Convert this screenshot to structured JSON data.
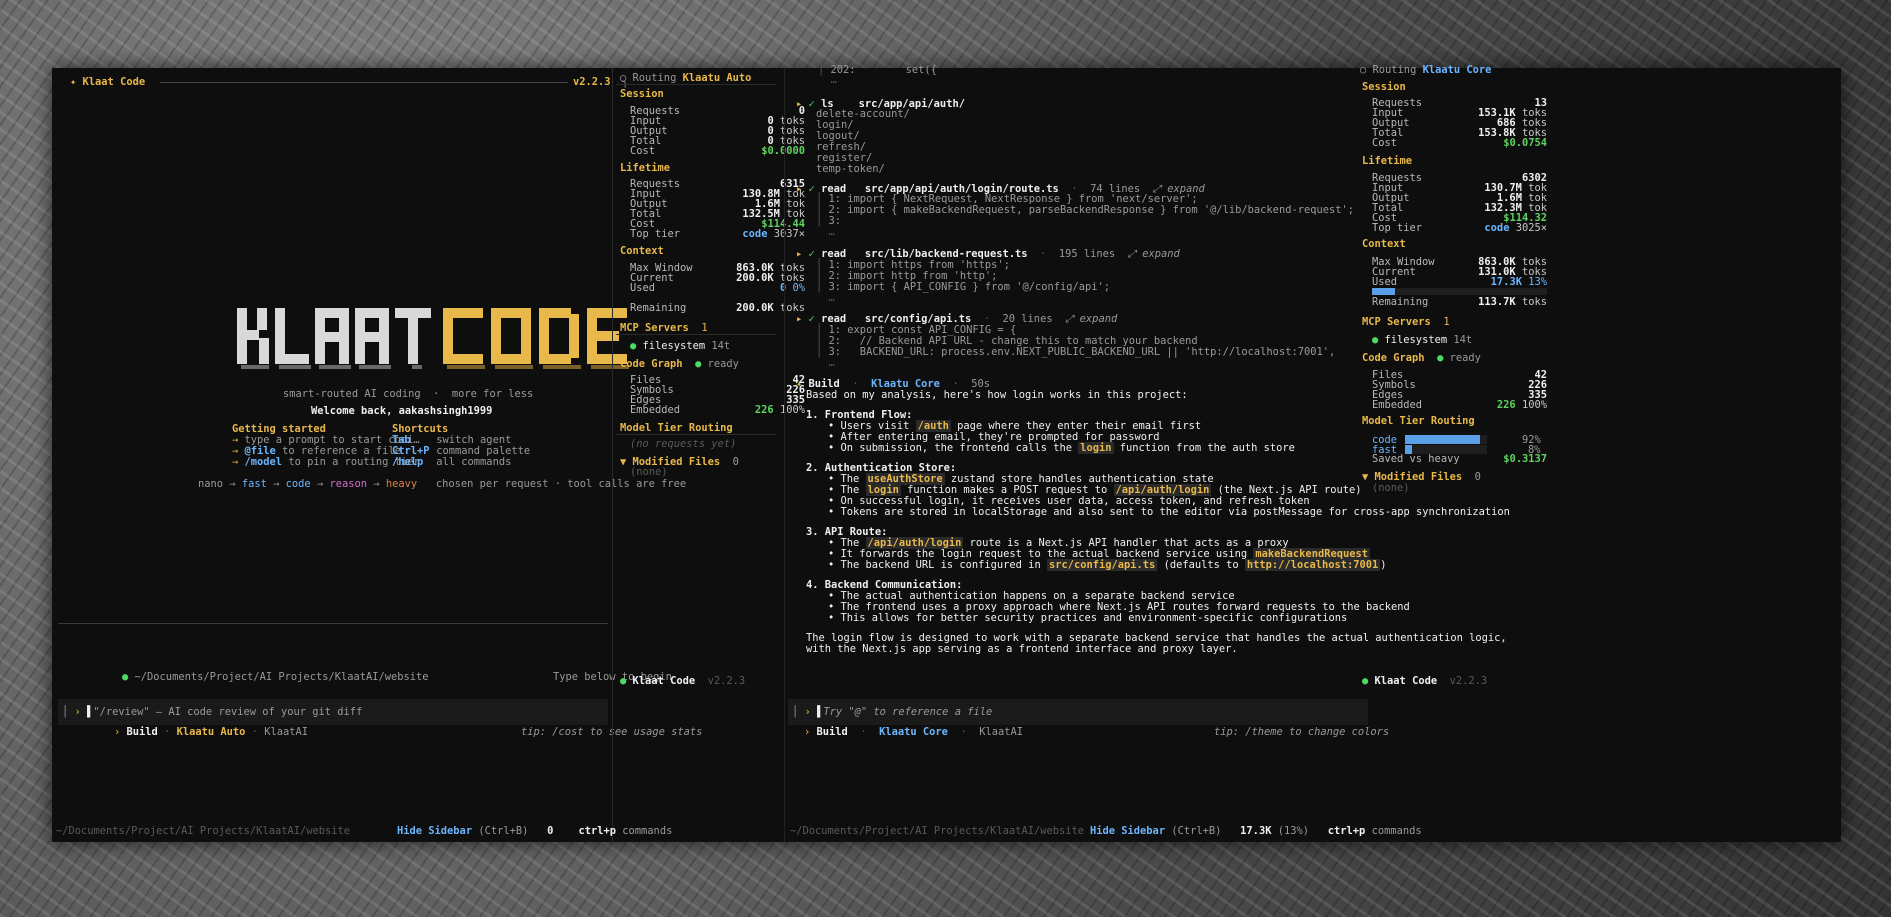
{
  "window1": {
    "title_icon": "✦",
    "title": "Klaat Code",
    "version": "v2.2.3",
    "logo_left": "KLAAT",
    "logo_right": "CODE",
    "tagline": "smart-routed AI coding  ·  more for less",
    "welcome": "Welcome back, aakashsingh1999",
    "getting_started": {
      "heading": "Getting started",
      "items": [
        {
          "arrow": "→",
          "key": "",
          "text": "type a prompt to start codi…"
        },
        {
          "arrow": "→",
          "key": "@file",
          "text": " to reference a file"
        },
        {
          "arrow": "→",
          "key": "/model",
          "text": " to pin a routing tier"
        }
      ]
    },
    "shortcuts": {
      "heading": "Shortcuts",
      "items": [
        {
          "key": "Tab",
          "text": "switch agent"
        },
        {
          "key": "Ctrl+P",
          "text": "command palette"
        },
        {
          "key": "/help",
          "text": "all commands"
        }
      ]
    },
    "tiers": [
      "nano",
      "fast",
      "code",
      "reason",
      "heavy"
    ],
    "tier_note": "chosen per request · tool calls are free",
    "path": "~/Documents/Project/AI Projects/KlaatAI/website",
    "type_hint": "Type below to begin",
    "input_placeholder": "\"/review\" — AI code review of your git diff",
    "mode": "Build",
    "model": "Klaatu Auto",
    "workspace": "KlaatAI",
    "tip": "tip: /cost to see usage stats",
    "footer_path": "~/Documents/Project/AI Projects/KlaatAI/website",
    "hide_sidebar": "Hide Sidebar",
    "hide_sidebar_key": "(Ctrl+B)",
    "token_count": "0",
    "cmd_key": "ctrl+p",
    "cmd_label": "commands"
  },
  "sidebar1": {
    "routing_label": "Routing",
    "routing_value": "Klaatu Auto",
    "session": {
      "heading": "Session",
      "rows": [
        {
          "k": "Requests",
          "v": "0",
          "u": ""
        },
        {
          "k": "Input",
          "v": "0",
          "u": "toks"
        },
        {
          "k": "Output",
          "v": "0",
          "u": "toks"
        },
        {
          "k": "Total",
          "v": "0",
          "u": "toks"
        },
        {
          "k": "Cost",
          "v": "$0.0000",
          "u": ""
        }
      ]
    },
    "lifetime": {
      "heading": "Lifetime",
      "rows": [
        {
          "k": "Requests",
          "v": "6315",
          "u": ""
        },
        {
          "k": "Input",
          "v": "130.8M",
          "u": "tok"
        },
        {
          "k": "Output",
          "v": "1.6M",
          "u": "tok"
        },
        {
          "k": "Total",
          "v": "132.5M",
          "u": "tok"
        },
        {
          "k": "Cost",
          "v": "$114.44",
          "u": ""
        },
        {
          "k": "Top tier",
          "v": "code",
          "u": "3037×"
        }
      ]
    },
    "context": {
      "heading": "Context",
      "rows": [
        {
          "k": "Max Window",
          "v": "863.0K",
          "u": "toks"
        },
        {
          "k": "Current",
          "v": "200.0K",
          "u": "toks"
        },
        {
          "k": "Used",
          "v": "0",
          "u": "0%"
        }
      ],
      "remaining_label": "Remaining",
      "remaining_value": "200.0K",
      "remaining_unit": "toks"
    },
    "mcp": {
      "heading": "MCP Servers",
      "count": "1",
      "server": "filesystem",
      "tools": "14t"
    },
    "code_graph": {
      "heading": "Code Graph",
      "status": "ready",
      "rows": [
        {
          "k": "Files",
          "v": "42",
          "u": ""
        },
        {
          "k": "Symbols",
          "v": "226",
          "u": ""
        },
        {
          "k": "Edges",
          "v": "335",
          "u": ""
        },
        {
          "k": "Embedded",
          "v": "226",
          "u": "100%"
        }
      ]
    },
    "model_tier": {
      "heading": "Model Tier Routing",
      "empty": "(no requests yet)"
    },
    "modified": {
      "heading": "Modified Files",
      "count": "0",
      "empty": "(none)"
    },
    "footer_brand": "Klaat Code",
    "footer_version": "v2.2.3"
  },
  "window2": {
    "top_lines": [
      {
        "n": "202:",
        "t": "        set({"
      },
      {
        "n": "…",
        "t": ""
      }
    ],
    "tools": [
      {
        "tool": "ls",
        "path": "src/app/api/auth/",
        "meta": "",
        "expand": "",
        "lines": [
          "delete-account/",
          "login/",
          "logout/",
          "refresh/",
          "register/",
          "temp-token/"
        ]
      },
      {
        "tool": "read",
        "path": "src/app/api/auth/login/route.ts",
        "meta": "74 lines",
        "expand": "expand",
        "lines": [
          "1: import { NextRequest, NextResponse } from 'next/server';",
          "2: import { makeBackendRequest, parseBackendResponse } from '@/lib/backend-request';",
          "3:",
          "…"
        ]
      },
      {
        "tool": "read",
        "path": "src/lib/backend-request.ts",
        "meta": "195 lines",
        "expand": "expand",
        "lines": [
          "1: import https from 'https';",
          "2: import http from 'http';",
          "3: import { API_CONFIG } from '@/config/api';",
          "…"
        ]
      },
      {
        "tool": "read",
        "path": "src/config/api.ts",
        "meta": "20 lines",
        "expand": "expand",
        "lines": [
          "1: export const API_CONFIG = {",
          "2:   // Backend API URL - change this to match your backend",
          "3:   BACKEND_URL: process.env.NEXT_PUBLIC_BACKEND_URL || 'http://localhost:7001',",
          "…"
        ]
      }
    ],
    "response": {
      "mode": "Build",
      "model": "Klaatu Core",
      "time": "50s",
      "intro": "Based on my analysis, here's how login works in this project:",
      "s1_title": "1. Frontend Flow:",
      "s1_l1a": "• Users visit ",
      "s1_l1_code": "/auth",
      "s1_l1b": " page where they enter their email first",
      "s1_l2": "• After entering email, they're prompted for password",
      "s1_l3a": "• On submission, the frontend calls the ",
      "s1_l3_code": "login",
      "s1_l3b": " function from the auth store",
      "s2_title": "2. Authentication Store:",
      "s2_l1a": "• The ",
      "s2_l1_code": "useAuthStore",
      "s2_l1b": " zustand store handles authentication state",
      "s2_l2a": "• The ",
      "s2_l2_code": "login",
      "s2_l2b": " function makes a POST request to ",
      "s2_l2_code2": "/api/auth/login",
      "s2_l2c": " (the Next.js API route)",
      "s2_l3": "• On successful login, it receives user data, access token, and refresh token",
      "s2_l4": "• Tokens are stored in localStorage and also sent to the editor via postMessage for cross-app synchronization",
      "s3_title": "3. API Route:",
      "s3_l1a": "• The ",
      "s3_l1_code": "/api/auth/login",
      "s3_l1b": " route is a Next.js API handler that acts as a proxy",
      "s3_l2a": "• It forwards the login request to the actual backend service using ",
      "s3_l2_code": "makeBackendRequest",
      "s3_l3a": "• The backend URL is configured in ",
      "s3_l3_code": "src/config/api.ts",
      "s3_l3b": " (defaults to ",
      "s3_l3_code2": "http://localhost:7001",
      "s3_l3c": ")",
      "s4_title": "4. Backend Communication:",
      "s4_l1": "• The actual authentication happens on a separate backend service",
      "s4_l2": "• The frontend uses a proxy approach where Next.js API routes forward requests to the backend",
      "s4_l3": "• This allows for better security practices and environment-specific configurations",
      "outro1": "The login flow is designed to work with a separate backend service that handles the actual authentication logic,",
      "outro2": "with the Next.js app serving as a frontend interface and proxy layer."
    },
    "input_placeholder": "Try \"@\" to reference a file",
    "mode": "Build",
    "model": "Klaatu Core",
    "workspace": "KlaatAI",
    "tip": "tip: /theme to change colors",
    "footer_path": "~/Documents/Project/AI Projects/KlaatAI/website",
    "hide_sidebar": "Hide Sidebar",
    "hide_sidebar_key": "(Ctrl+B)",
    "token_count": "17.3K",
    "token_pct": "(13%)",
    "cmd_key": "ctrl+p",
    "cmd_label": "commands"
  },
  "sidebar2": {
    "routing_label": "Routing",
    "routing_value": "Klaatu Core",
    "session": {
      "heading": "Session",
      "rows": [
        {
          "k": "Requests",
          "v": "13",
          "u": ""
        },
        {
          "k": "Input",
          "v": "153.1K",
          "u": "toks"
        },
        {
          "k": "Output",
          "v": "686",
          "u": "toks"
        },
        {
          "k": "Total",
          "v": "153.8K",
          "u": "toks"
        },
        {
          "k": "Cost",
          "v": "$0.0754",
          "u": ""
        }
      ]
    },
    "lifetime": {
      "heading": "Lifetime",
      "rows": [
        {
          "k": "Requests",
          "v": "6302",
          "u": ""
        },
        {
          "k": "Input",
          "v": "130.7M",
          "u": "tok"
        },
        {
          "k": "Output",
          "v": "1.6M",
          "u": "tok"
        },
        {
          "k": "Total",
          "v": "132.3M",
          "u": "tok"
        },
        {
          "k": "Cost",
          "v": "$114.32",
          "u": ""
        },
        {
          "k": "Top tier",
          "v": "code",
          "u": "3025×"
        }
      ]
    },
    "context": {
      "heading": "Context",
      "rows": [
        {
          "k": "Max Window",
          "v": "863.0K",
          "u": "toks"
        },
        {
          "k": "Current",
          "v": "131.0K",
          "u": "toks"
        },
        {
          "k": "Used",
          "v": "17.3K",
          "u": "13%"
        }
      ],
      "used_fraction": 0.13,
      "remaining_label": "Remaining",
      "remaining_value": "113.7K",
      "remaining_unit": "toks"
    },
    "mcp": {
      "heading": "MCP Servers",
      "count": "1",
      "server": "filesystem",
      "tools": "14t"
    },
    "code_graph": {
      "heading": "Code Graph",
      "status": "ready",
      "rows": [
        {
          "k": "Files",
          "v": "42",
          "u": ""
        },
        {
          "k": "Symbols",
          "v": "226",
          "u": ""
        },
        {
          "k": "Edges",
          "v": "335",
          "u": ""
        },
        {
          "k": "Embedded",
          "v": "226",
          "u": "100%"
        }
      ]
    },
    "model_tier": {
      "heading": "Model Tier Routing",
      "tiers": [
        {
          "name": "code",
          "pct": "92%",
          "fraction": 0.92
        },
        {
          "name": "fast",
          "pct": "8%",
          "fraction": 0.08
        }
      ],
      "saved_label": "Saved vs heavy",
      "saved_value": "$0.3137"
    },
    "modified": {
      "heading": "Modified Files",
      "count": "0",
      "empty": "(none)"
    },
    "footer_brand": "Klaat Code",
    "footer_version": "v2.2.3"
  },
  "colors": {
    "accent_yellow": "#e8b84a",
    "accent_blue": "#6cb6ff",
    "accent_green": "#5fd35f",
    "panel_bg": "#0e0e0e"
  }
}
